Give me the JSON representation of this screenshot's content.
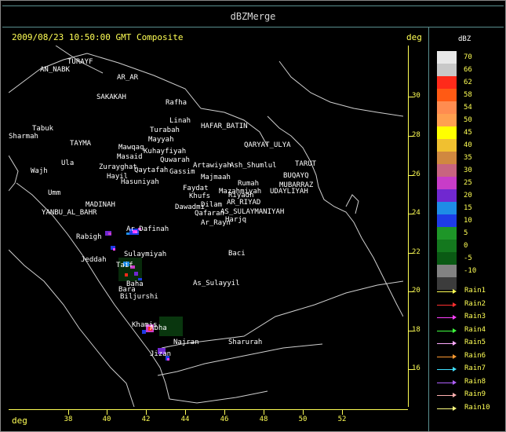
{
  "window": {
    "title": "dBZMerge"
  },
  "header": {
    "timestamp": "2009/08/23 10:50:00 GMT Composite",
    "deg_label": "deg"
  },
  "axes": {
    "lat_ticks": [
      "30",
      "28",
      "26",
      "24",
      "22",
      "20",
      "18",
      "16"
    ],
    "lon_ticks": [
      "38",
      "40",
      "42",
      "44",
      "46",
      "48",
      "50",
      "52"
    ],
    "lon_label": "deg"
  },
  "legend": {
    "unit": "dBZ",
    "levels": [
      {
        "label": "70",
        "color": "#e8e8e8"
      },
      {
        "label": "66",
        "color": "#c8c8c8"
      },
      {
        "label": "62",
        "color": "#ff2a1a"
      },
      {
        "label": "58",
        "color": "#ff5a14"
      },
      {
        "label": "54",
        "color": "#ff8c50"
      },
      {
        "label": "50",
        "color": "#ffa050"
      },
      {
        "label": "45",
        "color": "#ffff00"
      },
      {
        "label": "40",
        "color": "#f0c030"
      },
      {
        "label": "35",
        "color": "#d08840"
      },
      {
        "label": "30",
        "color": "#c86480"
      },
      {
        "label": "25",
        "color": "#c83cc8"
      },
      {
        "label": "20",
        "color": "#7028d0"
      },
      {
        "label": "15",
        "color": "#1e8ce6"
      },
      {
        "label": "10",
        "color": "#1e3ce6"
      },
      {
        "label": "5",
        "color": "#1e9628"
      },
      {
        "label": "0",
        "color": "#14781e"
      },
      {
        "label": "-5",
        "color": "#0a5a14"
      },
      {
        "label": "-10",
        "color": "#828282"
      },
      {
        "label": "",
        "color": "#3c3c3c"
      }
    ],
    "rain": [
      {
        "label": "Rain1",
        "color": "#ffff55"
      },
      {
        "label": "Rain2",
        "color": "#ff3030"
      },
      {
        "label": "Rain3",
        "color": "#ff40ff"
      },
      {
        "label": "Rain4",
        "color": "#40ff40"
      },
      {
        "label": "Rain5",
        "color": "#ffaaff"
      },
      {
        "label": "Rain6",
        "color": "#ff9a30"
      },
      {
        "label": "Rain7",
        "color": "#40e0ff"
      },
      {
        "label": "Rain8",
        "color": "#b060ff"
      },
      {
        "label": "Rain9",
        "color": "#ffb0b0"
      },
      {
        "label": "Rain10",
        "color": "#ffff80"
      }
    ]
  },
  "map": {
    "places": [
      {
        "name": "TURAYF",
        "color": "#ffffff"
      },
      {
        "name": "AR_AR",
        "color": "#ffffff"
      },
      {
        "name": "AN_NABK",
        "color": "#ffffff"
      },
      {
        "name": "SAKAKAH",
        "color": "#ffffff"
      },
      {
        "name": "Rafha",
        "color": "#ffffff"
      },
      {
        "name": "Linah",
        "color": "#ffffff"
      },
      {
        "name": "Turabah",
        "color": "#ffffff"
      },
      {
        "name": "HAFAR_BATIN",
        "color": "#ffffff"
      },
      {
        "name": "Mayyah",
        "color": "#ffffff"
      },
      {
        "name": "QARYAT_ULYA",
        "color": "#ffffff"
      },
      {
        "name": "Tabuk",
        "color": "#ffffff"
      },
      {
        "name": "Sharmah",
        "color": "#ffffff"
      },
      {
        "name": "TAYMA",
        "color": "#ffffff"
      },
      {
        "name": "Ula",
        "color": "#ffffff"
      },
      {
        "name": "Mawqaq",
        "color": "#ffffff"
      },
      {
        "name": "Masaid",
        "color": "#ffffff"
      },
      {
        "name": "Kuhayfiyah",
        "color": "#ffffff"
      },
      {
        "name": "Quwarah",
        "color": "#ffffff"
      },
      {
        "name": "Artawiyah",
        "color": "#ffffff"
      },
      {
        "name": "Ash_Shumlul",
        "color": "#ffffff"
      },
      {
        "name": "TARUT",
        "color": "#ffffff"
      },
      {
        "name": "BUQAYQ",
        "color": "#ffffff"
      },
      {
        "name": "MUBARRAZ",
        "color": "#ffffff"
      },
      {
        "name": "UDAYLIYAH",
        "color": "#ffffff"
      },
      {
        "name": "Wajh",
        "color": "#ffffff"
      },
      {
        "name": "Zurayghat",
        "color": "#ffffff"
      },
      {
        "name": "Hayil",
        "color": "#ffffff"
      },
      {
        "name": "Qaytafah",
        "color": "#ffffff"
      },
      {
        "name": "Gassim",
        "color": "#ffffff"
      },
      {
        "name": "Majmaah",
        "color": "#ffffff"
      },
      {
        "name": "Rumah",
        "color": "#ffffff"
      },
      {
        "name": "Hasuniyah",
        "color": "#ffffff"
      },
      {
        "name": "Faydat",
        "color": "#ffffff"
      },
      {
        "name": "Khufs",
        "color": "#ffffff"
      },
      {
        "name": "Mazahmiyah",
        "color": "#ffffff"
      },
      {
        "name": "Riyadh",
        "color": "#ffffff"
      },
      {
        "name": "AR_RIYAD",
        "color": "#ffffff"
      },
      {
        "name": "Umm",
        "color": "#ffffff"
      },
      {
        "name": "MADINAH",
        "color": "#ffffff"
      },
      {
        "name": "Dawadmi",
        "color": "#ffffff"
      },
      {
        "name": "Dilam",
        "color": "#ffffff"
      },
      {
        "name": "AS_SULAYMANIYAH",
        "color": "#ffffff"
      },
      {
        "name": "YANBU_AL_BAHR",
        "color": "#ffffff"
      },
      {
        "name": "Qafaran",
        "color": "#ffffff"
      },
      {
        "name": "Harjq",
        "color": "#ffffff"
      },
      {
        "name": "Ar_Rayn",
        "color": "#ffffff"
      },
      {
        "name": "Ar_Dafinah",
        "color": "#ffffff"
      },
      {
        "name": "Rabigh",
        "color": "#ffffff"
      },
      {
        "name": "Sulaymiyah",
        "color": "#ffffff"
      },
      {
        "name": "Baci",
        "color": "#ffffff"
      },
      {
        "name": "Jeddah",
        "color": "#ffffff"
      },
      {
        "name": "Taif",
        "color": "#ffffff"
      },
      {
        "name": "Baha",
        "color": "#ffffff"
      },
      {
        "name": "Bara",
        "color": "#ffffff"
      },
      {
        "name": "As_Sulayyil",
        "color": "#ffffff"
      },
      {
        "name": "Biljurshi",
        "color": "#ffffff"
      },
      {
        "name": "Khamis",
        "color": "#ffffff"
      },
      {
        "name": "Abha",
        "color": "#ffffff"
      },
      {
        "name": "Sharurah",
        "color": "#ffffff"
      },
      {
        "name": "Najran",
        "color": "#ffffff"
      },
      {
        "name": "Jizan",
        "color": "#ffffff"
      }
    ]
  }
}
